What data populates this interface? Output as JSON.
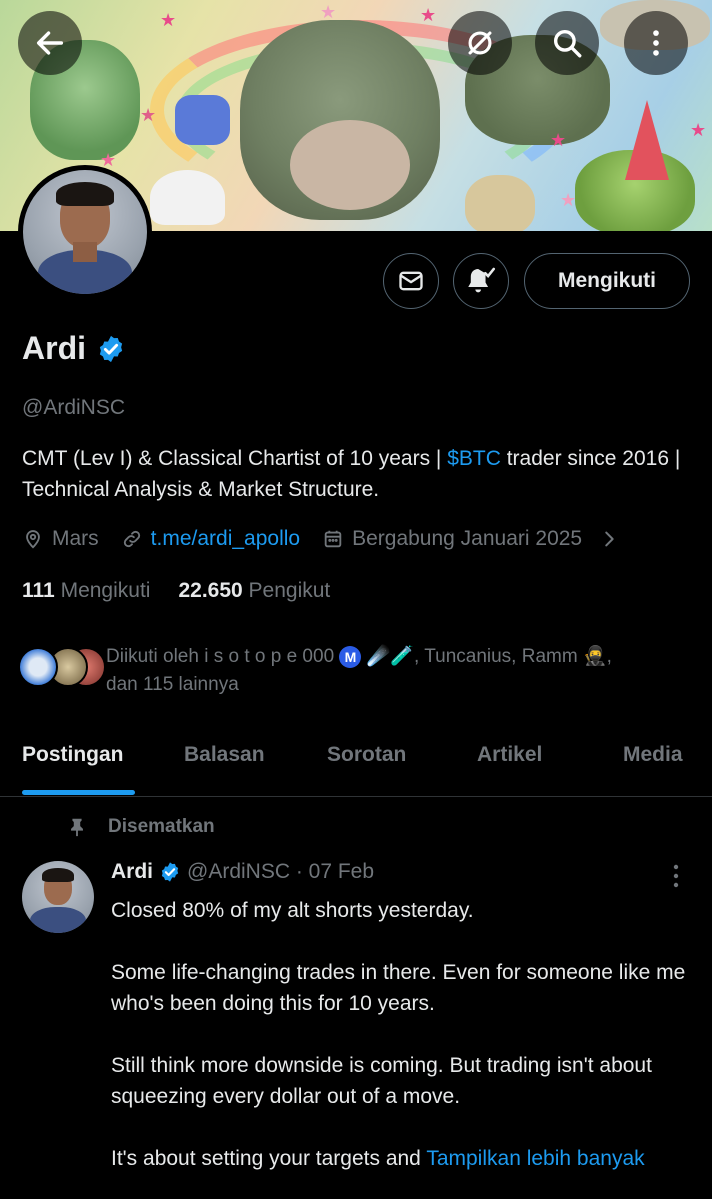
{
  "header": {
    "back_icon": "arrow-left-icon",
    "grok_icon": "grok-icon",
    "search_icon": "search-icon",
    "more_icon": "more-vertical-icon"
  },
  "profile": {
    "name": "Ardi",
    "handle": "@ArdiNSC",
    "bio_prefix": "CMT (Lev I) & Classical Chartist of 10 years | ",
    "bio_cashtag": "$BTC",
    "bio_suffix": " trader since 2016 | Technical Analysis & Market Structure.",
    "location": "Mars",
    "website": "t.me/ardi_apollo",
    "joined": "Bergabung Januari 2025",
    "following_count": "111",
    "following_label": "Mengikuti",
    "followers_count": "22.650",
    "followers_label": "Pengikut",
    "followed_by_prefix": "Diikuti oleh i s o t o p e 000 ",
    "followed_by_badge": "M",
    "followed_by_emoji": " ☄️🧪",
    "followed_by_suffix": ", Tuncanius, Ramm 🥷,",
    "followed_by_line2": "dan 115 lainnya"
  },
  "actions": {
    "message_icon": "envelope-icon",
    "notify_icon": "bell-check-icon",
    "follow_label": "Mengikuti"
  },
  "tabs": [
    {
      "label": "Postingan",
      "active": true
    },
    {
      "label": "Balasan",
      "active": false
    },
    {
      "label": "Sorotan",
      "active": false
    },
    {
      "label": "Artikel",
      "active": false
    },
    {
      "label": "Media",
      "active": false
    }
  ],
  "post": {
    "pinned_label": "Disematkan",
    "author": "Ardi",
    "meta": "@ArdiNSC · 07 Feb",
    "paragraphs": [
      "Closed 80% of my alt shorts yesterday.",
      "Some life-changing trades in there. Even for someone like me who's been doing this for 10 years.",
      "Still think more downside is coming. But trading isn't about squeezing every dollar out of a move."
    ],
    "last_paragraph": "It's about setting your targets and ",
    "show_more": "Tampilkan lebih banyak"
  },
  "colors": {
    "accent": "#1d9bf0",
    "muted": "#71767b",
    "text": "#e7e9ea",
    "border": "#2f3336"
  }
}
